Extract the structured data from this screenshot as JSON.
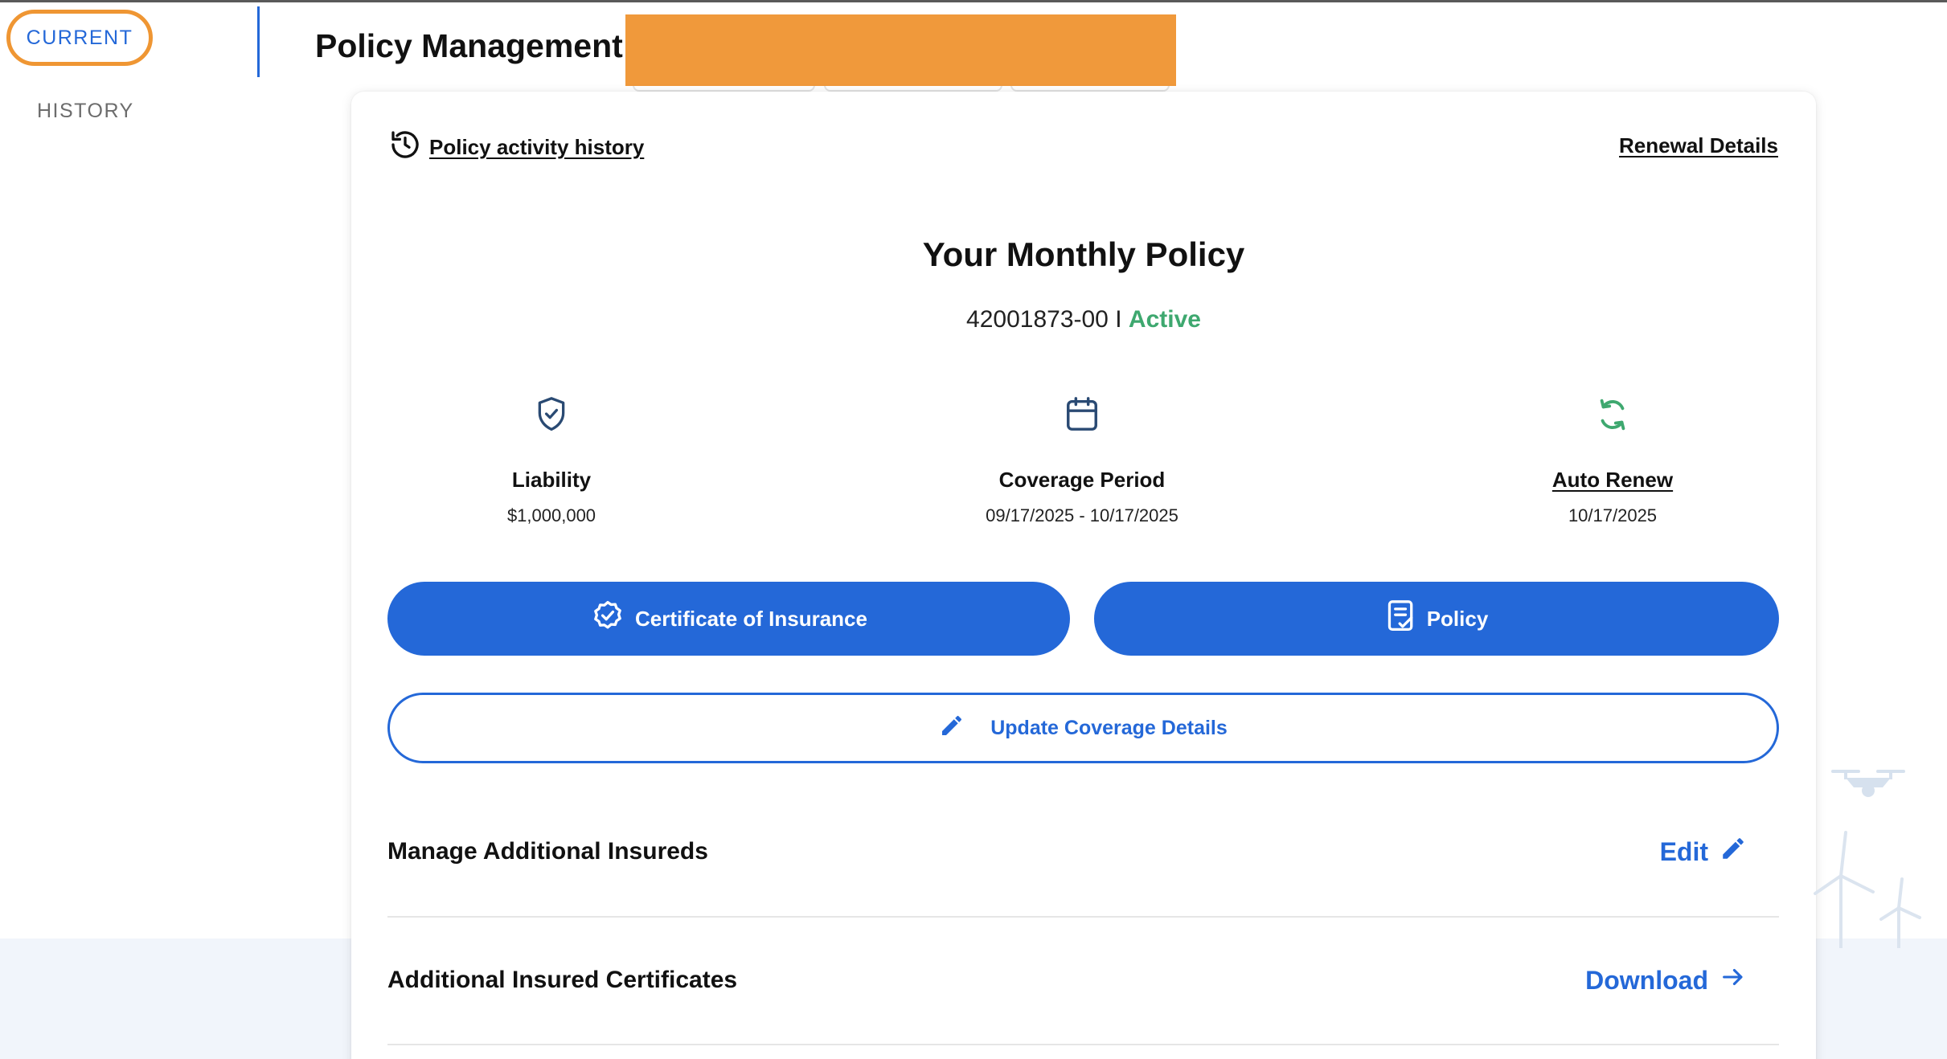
{
  "sidebar": {
    "tabs": [
      {
        "label": "CURRENT",
        "active": true
      },
      {
        "label": "HISTORY",
        "active": false
      }
    ]
  },
  "header": {
    "title": "Policy Management"
  },
  "card": {
    "activity_link": "Policy activity history",
    "renewal_link": "Renewal Details",
    "title": "Your Monthly Policy",
    "policy_number": "42001873-00",
    "separator": "I",
    "status": "Active",
    "metrics": [
      {
        "label": "Liability",
        "value": "$1,000,000",
        "icon": "shield-check-icon"
      },
      {
        "label": "Coverage Period",
        "value": "09/17/2025 - 10/17/2025",
        "icon": "calendar-icon"
      },
      {
        "label": "Auto Renew",
        "value": "10/17/2025",
        "icon": "refresh-icon"
      }
    ],
    "buttons": {
      "certificate": "Certificate of Insurance",
      "policy": "Policy",
      "update_coverage": "Update Coverage Details"
    },
    "rows": [
      {
        "label": "Manage Additional Insureds",
        "action": "Edit"
      },
      {
        "label": "Additional Insured Certificates",
        "action": "Download"
      }
    ]
  },
  "colors": {
    "accent": "#2468d8",
    "active_status": "#3ea86f",
    "highlight_ring": "#ef9633",
    "redaction": "#f0993b"
  }
}
